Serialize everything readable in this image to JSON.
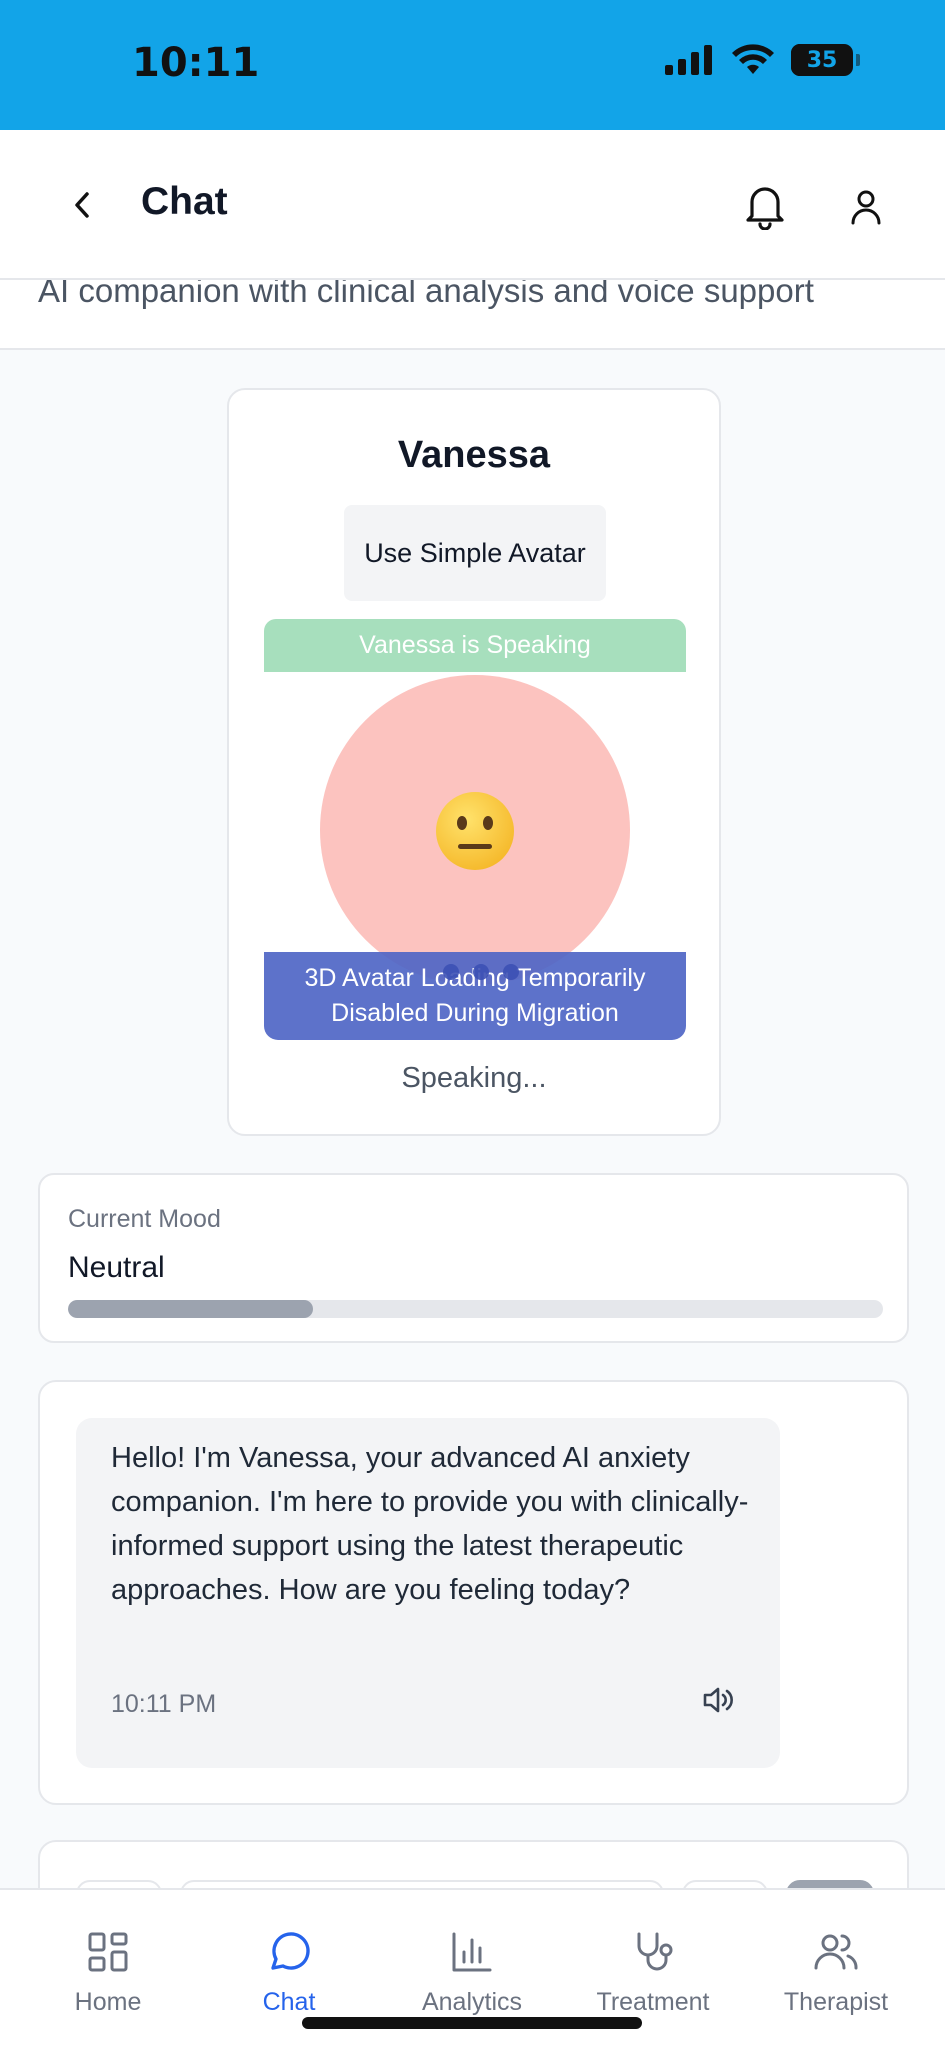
{
  "status_bar": {
    "time": "10:11",
    "battery_level": "35",
    "background": "#12a4e8"
  },
  "header": {
    "title": "Chat",
    "icons": [
      "chevron-left-icon",
      "bell-icon",
      "user-icon"
    ]
  },
  "subtitle": "AI companion with clinical analysis and voice support",
  "avatar_card": {
    "name": "Vanessa",
    "simple_avatar_button": "Use Simple Avatar",
    "speaking_banner": "Vanessa is Speaking",
    "emoji": "neutral-face",
    "migration_notice_line1": "3D Avatar Loading Temporarily",
    "migration_notice_line2": "Disabled During Migration",
    "status": "Speaking..."
  },
  "mood": {
    "label": "Current Mood",
    "value": "Neutral",
    "level": 0.3
  },
  "chat": {
    "messages": [
      {
        "text": "Hello! I'm Vanessa, your advanced AI anxiety companion. I'm here to provide you with clinically-informed support using the latest therapeutic approaches. How are you feeling today?",
        "time": "10:11 PM"
      }
    ]
  },
  "nav": {
    "items": [
      {
        "label": "Home",
        "icon": "grid-icon",
        "active": false
      },
      {
        "label": "Chat",
        "icon": "message-circle-icon",
        "active": true
      },
      {
        "label": "Analytics",
        "icon": "bar-chart-icon",
        "active": false
      },
      {
        "label": "Treatment",
        "icon": "stethoscope-icon",
        "active": false
      },
      {
        "label": "Therapist",
        "icon": "users-icon",
        "active": false
      }
    ]
  },
  "colors": {
    "accent": "#2563eb",
    "speaking": "#a7dfbd",
    "avatar": "#fcc3bf",
    "notice": "#4f66c5"
  }
}
